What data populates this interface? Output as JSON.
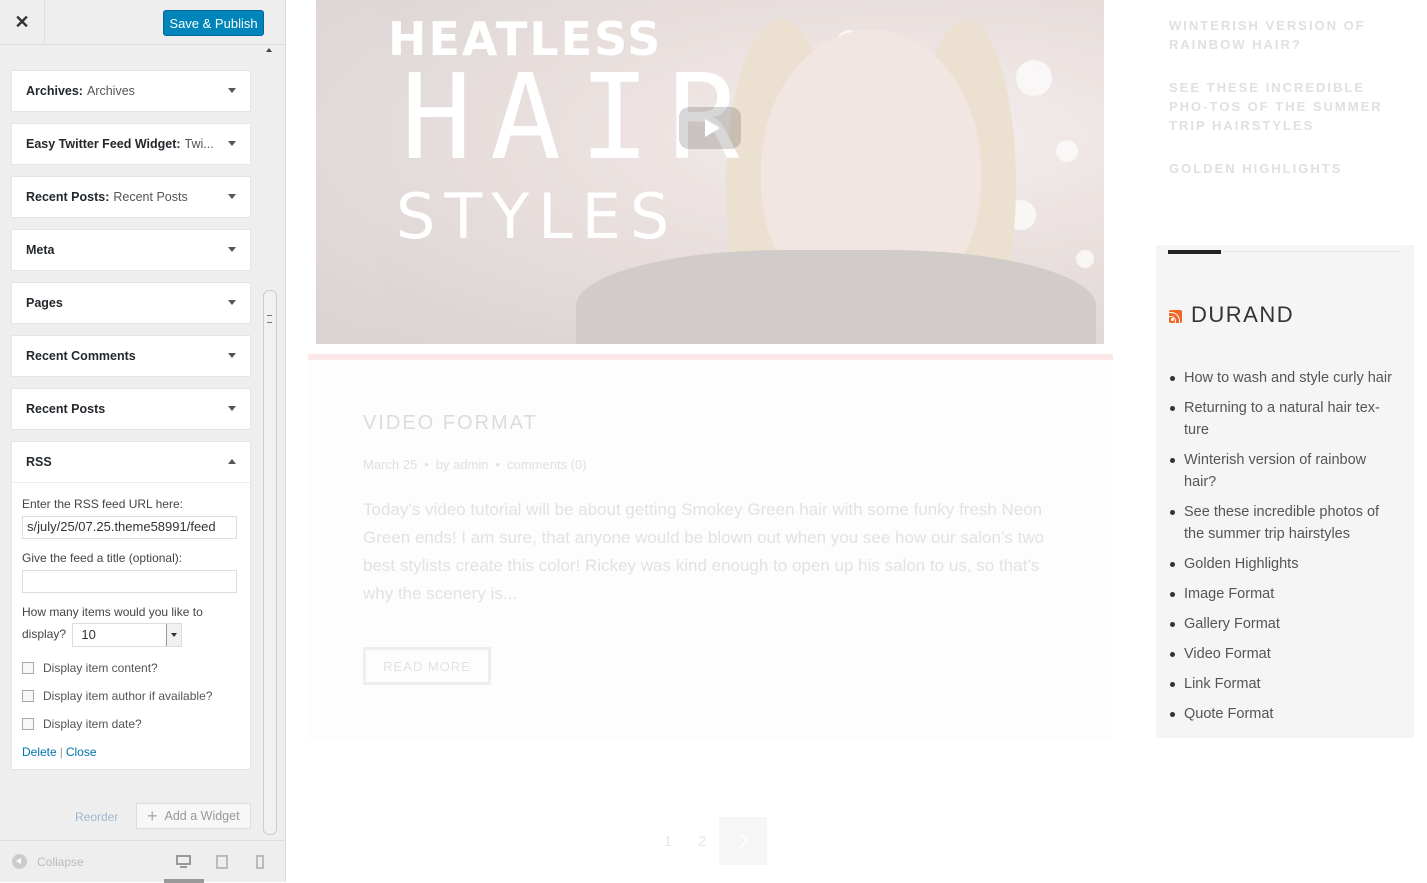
{
  "customizer": {
    "close_symbol": "✕",
    "save_label": "Save & Publish",
    "widgets": [
      {
        "title": "Archives:",
        "subtitle": "Archives"
      },
      {
        "title": "Easy Twitter Feed Widget:",
        "subtitle": "Twi..."
      },
      {
        "title": "Recent Posts:",
        "subtitle": "Recent Posts"
      },
      {
        "title": "Meta",
        "subtitle": ""
      },
      {
        "title": "Pages",
        "subtitle": ""
      },
      {
        "title": "Recent Comments",
        "subtitle": ""
      },
      {
        "title": "Recent Posts",
        "subtitle": ""
      }
    ],
    "rss_widget": {
      "title": "RSS",
      "url_label": "Enter the RSS feed URL here:",
      "url_value": "s/july/25/07.25.theme58991/feed",
      "title_label": "Give the feed a title (optional):",
      "title_value": "",
      "items_label_1": "How many items would you like to",
      "items_label_2": "display?",
      "items_value": "10",
      "opt_content": "Display item content?",
      "opt_author": "Display item author if available?",
      "opt_date": "Display item date?",
      "delete_label": "Delete",
      "separator": "|",
      "close_label": "Close"
    },
    "reorder_label": "Reorder",
    "add_widget_label": "Add a Widget",
    "add_widget_symbol": "+",
    "collapse_label": "Collapse"
  },
  "preview": {
    "video": {
      "title_line1": "HEATLESS",
      "title_line2": "HAIR",
      "title_line3": "STYLES"
    },
    "post": {
      "title": "VIDEO FORMAT",
      "date": "March 25",
      "by": "by",
      "author": "admin",
      "comments": "comments (0)",
      "excerpt": "Today’s video tutorial will be about getting Smokey Green hair with some funky fresh Neon Green ends! I am sure, that anyone would be blown out when you see how our salon’s two best stylists create this color! Rickey was kind enough to open up his salon to us, so that’s why the scenery is...",
      "read_more": "READ MORE"
    },
    "pagination": {
      "page1": "1",
      "page2": "2"
    },
    "top_list": [
      "WINTERISH VERSION OF RAINBOW HAIR?",
      "SEE THESE INCREDIBLE PHO-TOS OF THE SUMMER TRIP HAIRSTYLES",
      "GOLDEN HIGHLIGHTS"
    ],
    "rss": {
      "title": "DURAND",
      "items": [
        "How to wash and style curly hair",
        "Returning to a natural hair tex-ture",
        "Winterish version of rainbow hair?",
        "See these incredible photos of the summer trip hairstyles",
        "Golden Highlights",
        "Image Format",
        "Gallery Format",
        "Video Format",
        "Link Format",
        "Quote Format"
      ]
    }
  },
  "colors": {
    "publish_blue": "#0085ba",
    "link_blue": "#0073aa",
    "rss_orange": "#f26522",
    "pink_accent": "#fbe9ea"
  }
}
